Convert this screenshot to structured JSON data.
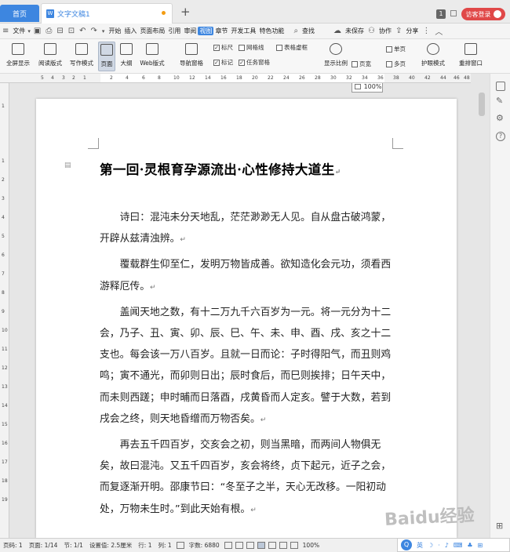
{
  "tabs": {
    "home": "首页",
    "document": "文字文稿1",
    "new_tab": "+"
  },
  "topright": {
    "window_badge": "1",
    "visitor_login": "访客登录"
  },
  "menubar": {
    "file": "文件",
    "items": [
      "开始",
      "插入",
      "页面布局",
      "引用",
      "审阅",
      "视图",
      "章节",
      "开发工具",
      "特色功能"
    ],
    "active_index": 5,
    "search": "查找",
    "unsaved": "未保存",
    "collab": "协作",
    "share": "分享"
  },
  "ribbon": {
    "fullscreen": "全屏显示",
    "reading": "阅读版式",
    "writing": "写作模式",
    "page": "页面",
    "outline": "大纲",
    "web": "Web版式",
    "nav_pane": "导航窗格",
    "ruler": "标尺",
    "gridlines": "网格线",
    "table_dotted": "表格虚框",
    "markers": "标记",
    "task_pane": "任务窗格",
    "zoom_ratio": "显示比例",
    "zoom_value": "100%",
    "single_page": "单页",
    "page_width": "页宽",
    "multi_page": "多页",
    "eye_mode": "护眼模式",
    "arrange_windows": "重排窗口"
  },
  "ruler": {
    "h_ticks": [
      "5",
      "4",
      "3",
      "2",
      "1",
      "2",
      "4",
      "6",
      "8",
      "10",
      "12",
      "14",
      "16",
      "18",
      "20",
      "22",
      "24",
      "26",
      "28",
      "30",
      "32",
      "34",
      "36",
      "38",
      "40",
      "42",
      "44",
      "46",
      "48"
    ],
    "v_ticks": [
      "1",
      "1",
      "2",
      "3",
      "4",
      "5",
      "6",
      "7",
      "8",
      "9",
      "10",
      "11",
      "12",
      "13",
      "14",
      "15",
      "16",
      "17",
      "18",
      "19"
    ]
  },
  "document": {
    "heading": "第一回·灵根育孕源流出·心性修持大道生",
    "paragraphs": [
      "诗曰：混沌未分天地乱，茫茫渺渺无人见。自从盘古破鸿蒙，开辟从兹清浊辨。",
      "覆载群生仰至仁，发明万物皆成善。欲知造化会元功，须看西游释厄传。",
      "盖闻天地之数，有十二万九千六百岁为一元。将一元分为十二会，乃子、丑、寅、卯、辰、巳、午、未、申、酉、戌、亥之十二支也。每会该一万八百岁。且就一日而论：子时得阳气，而丑则鸡鸣；寅不通光，而卯则日出；辰时食后，而巳则挨排；日午天中，而未则西蹉；申时晡而日落酉，戌黄昏而人定亥。譬于大数，若到戌会之终，则天地昏缯而万物否矣。",
      "再去五千四百岁，交亥会之初，则当黑暗，而两间人物俱无矣，故曰混沌。又五千四百岁，亥会将终，贞下起元，近子之会，而复逐渐开明。邵康节曰：“冬至子之半，天心无改移。一阳初动处，万物未生时。”到此天始有根。"
    ],
    "return_mark": "↵"
  },
  "watermark": "Baidu经验",
  "statusbar": {
    "page_num": "页码: 1",
    "pages": "页面: 1/14",
    "section": "节: 1/1",
    "setting": "设置值: 2.5厘米",
    "row": "行: 1",
    "col": "列: 1",
    "word_count": "字数: 6880",
    "zoom": "100%",
    "ime": "英"
  }
}
